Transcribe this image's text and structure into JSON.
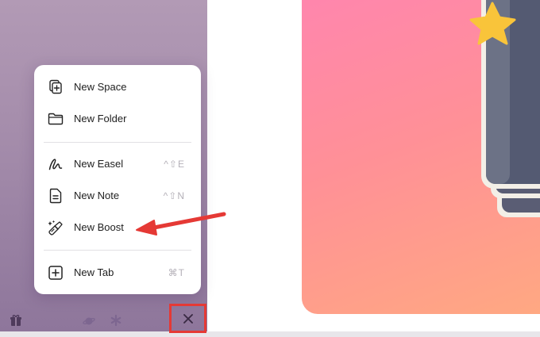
{
  "menu": {
    "items": [
      {
        "label": "New Space",
        "icon": "new-space-icon",
        "shortcut": ""
      },
      {
        "label": "New Folder",
        "icon": "folder-icon",
        "shortcut": ""
      },
      {
        "label": "New Easel",
        "icon": "easel-squiggle-icon",
        "shortcut": "^⇧E"
      },
      {
        "label": "New Note",
        "icon": "note-icon",
        "shortcut": "^⇧N"
      },
      {
        "label": "New Boost",
        "icon": "boost-wand-icon",
        "shortcut": ""
      },
      {
        "label": "New Tab",
        "icon": "plus-square-icon",
        "shortcut": "⌘T"
      }
    ]
  },
  "annotations": {
    "arrow_color": "#e53935",
    "highlight_color": "#e53935",
    "arrow_points_to": "New Boost",
    "highlighted": "close-button"
  },
  "colors": {
    "sidebar_top": "#b29ab5",
    "sidebar_bottom": "#8e769b",
    "art_gradient_start": "#ff86ad",
    "art_gradient_end": "#ffa882"
  }
}
